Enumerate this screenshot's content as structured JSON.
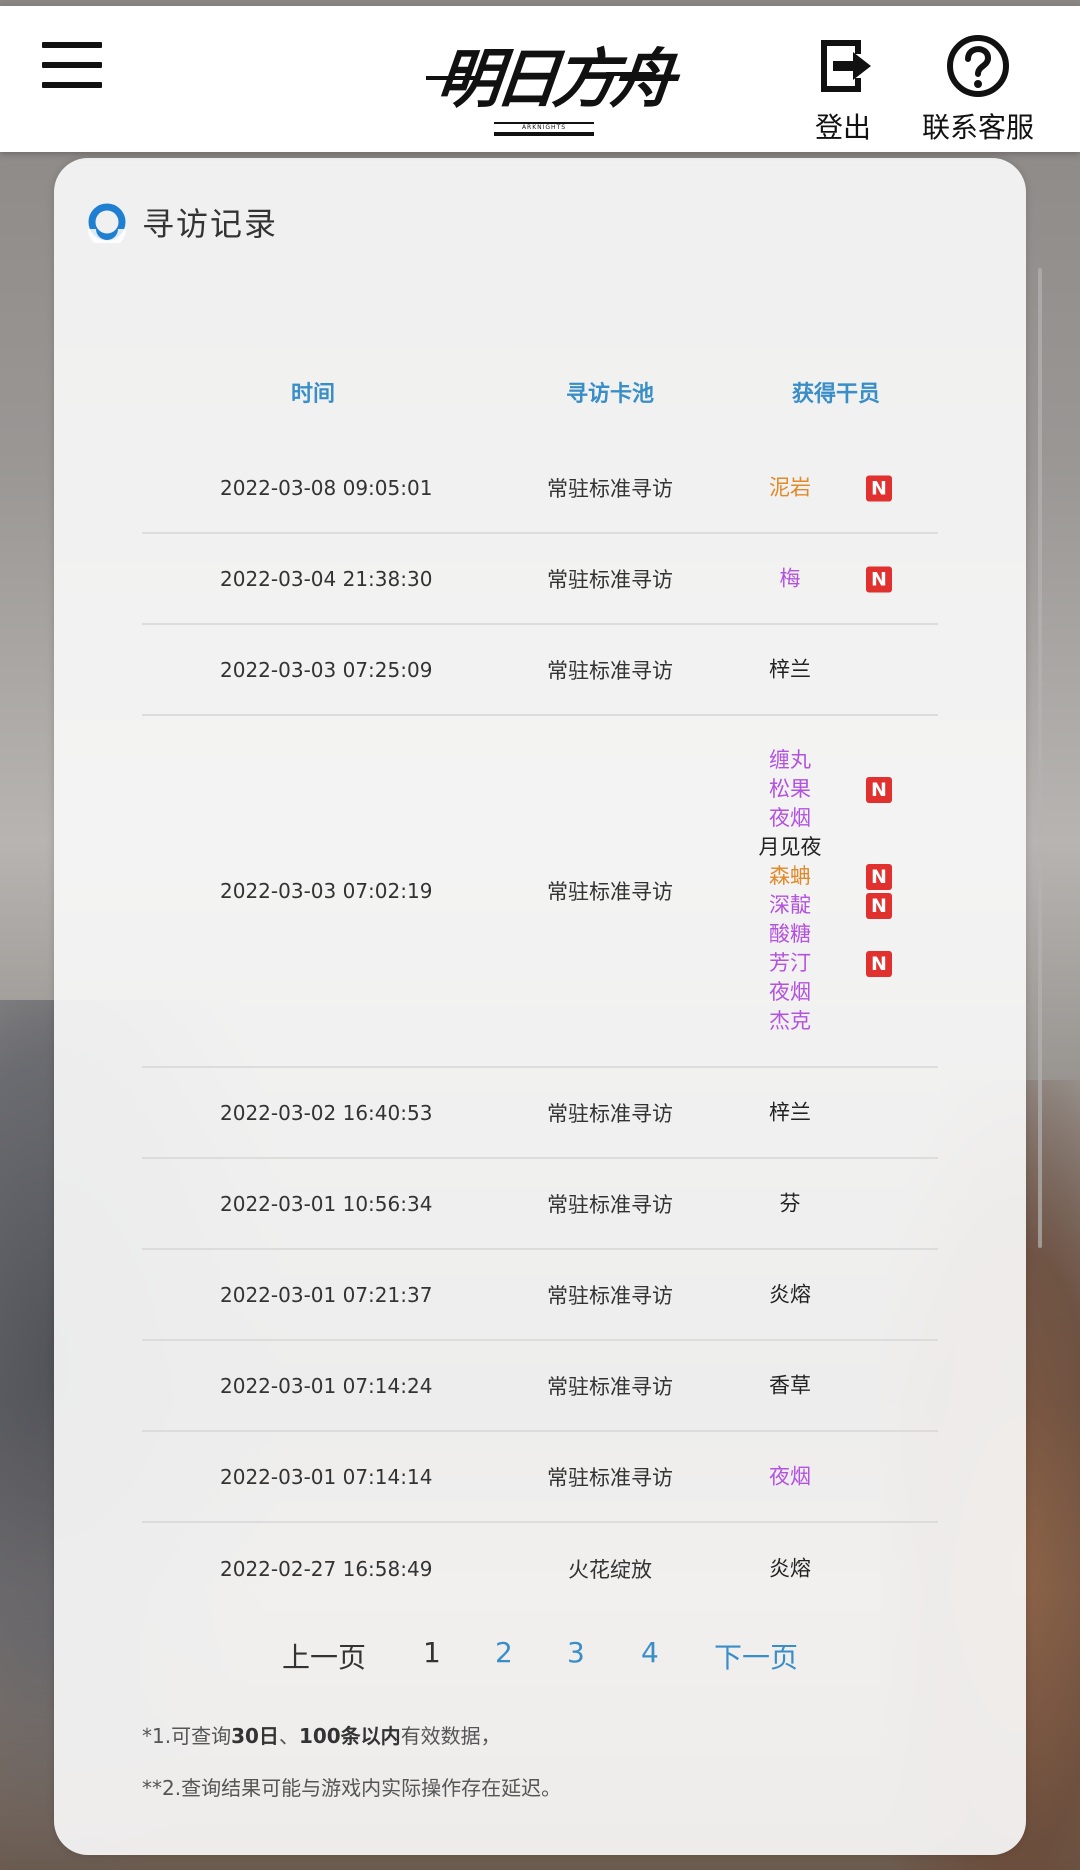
{
  "header": {
    "logo_text": "明日方舟",
    "logo_sub": "ARKNIGHTS",
    "logout_label": "登出",
    "support_label": "联系客服"
  },
  "card": {
    "title": "寻访记录"
  },
  "table": {
    "headers": [
      "时间",
      "寻访卡池",
      "获得干员"
    ],
    "rows": [
      {
        "time": "2022-03-08 09:05:01",
        "pool": "常驻标准寻访",
        "ops": [
          {
            "name": "泥岩",
            "color": "#e08a2a",
            "new": "N"
          }
        ]
      },
      {
        "time": "2022-03-04 21:38:30",
        "pool": "常驻标准寻访",
        "ops": [
          {
            "name": "梅",
            "color": "#b452e0",
            "new": "N"
          }
        ]
      },
      {
        "time": "2022-03-03 07:25:09",
        "pool": "常驻标准寻访",
        "ops": [
          {
            "name": "梓兰",
            "color": "#222222"
          }
        ]
      },
      {
        "time": "2022-03-03 07:02:19",
        "pool": "常驻标准寻访",
        "ops": [
          {
            "name": "缠丸",
            "color": "#b452e0"
          },
          {
            "name": "松果",
            "color": "#b452e0",
            "new": "N"
          },
          {
            "name": "夜烟",
            "color": "#b452e0"
          },
          {
            "name": "月见夜",
            "color": "#222222"
          },
          {
            "name": "森蚺",
            "color": "#e08a2a",
            "new": "N"
          },
          {
            "name": "深靛",
            "color": "#b452e0",
            "new": "N"
          },
          {
            "name": "酸糖",
            "color": "#b452e0"
          },
          {
            "name": "芳汀",
            "color": "#b452e0",
            "new": "N"
          },
          {
            "name": "夜烟",
            "color": "#b452e0"
          },
          {
            "name": "杰克",
            "color": "#b452e0"
          }
        ]
      },
      {
        "time": "2022-03-02 16:40:53",
        "pool": "常驻标准寻访",
        "ops": [
          {
            "name": "梓兰",
            "color": "#222222"
          }
        ]
      },
      {
        "time": "2022-03-01 10:56:34",
        "pool": "常驻标准寻访",
        "ops": [
          {
            "name": "芬",
            "color": "#222222"
          }
        ]
      },
      {
        "time": "2022-03-01 07:21:37",
        "pool": "常驻标准寻访",
        "ops": [
          {
            "name": "炎熔",
            "color": "#222222"
          }
        ]
      },
      {
        "time": "2022-03-01 07:14:24",
        "pool": "常驻标准寻访",
        "ops": [
          {
            "name": "香草",
            "color": "#222222"
          }
        ]
      },
      {
        "time": "2022-03-01 07:14:14",
        "pool": "常驻标准寻访",
        "ops": [
          {
            "name": "夜烟",
            "color": "#b452e0"
          }
        ]
      },
      {
        "time": "2022-02-27 16:58:49",
        "pool": "火花绽放",
        "ops": [
          {
            "name": "炎熔",
            "color": "#222222"
          }
        ]
      }
    ]
  },
  "pager": {
    "prev": "上一页",
    "pages": [
      "1",
      "2",
      "3",
      "4"
    ],
    "current": "1",
    "next": "下一页"
  },
  "notes": {
    "n1_prefix": "*1.可查询",
    "n1_bold1": "30日",
    "n1_sep": "、",
    "n1_bold2": "100条以内",
    "n1_suffix": "有效数据，",
    "n2": "**2.查询结果可能与游戏内实际操作存在延迟。"
  },
  "colors": {
    "accent": "#3a8ec8",
    "rarity6": "#e08a2a",
    "rarity5": "#e08a2a",
    "rarity4": "#b452e0",
    "new_badge": "#e0312f"
  }
}
